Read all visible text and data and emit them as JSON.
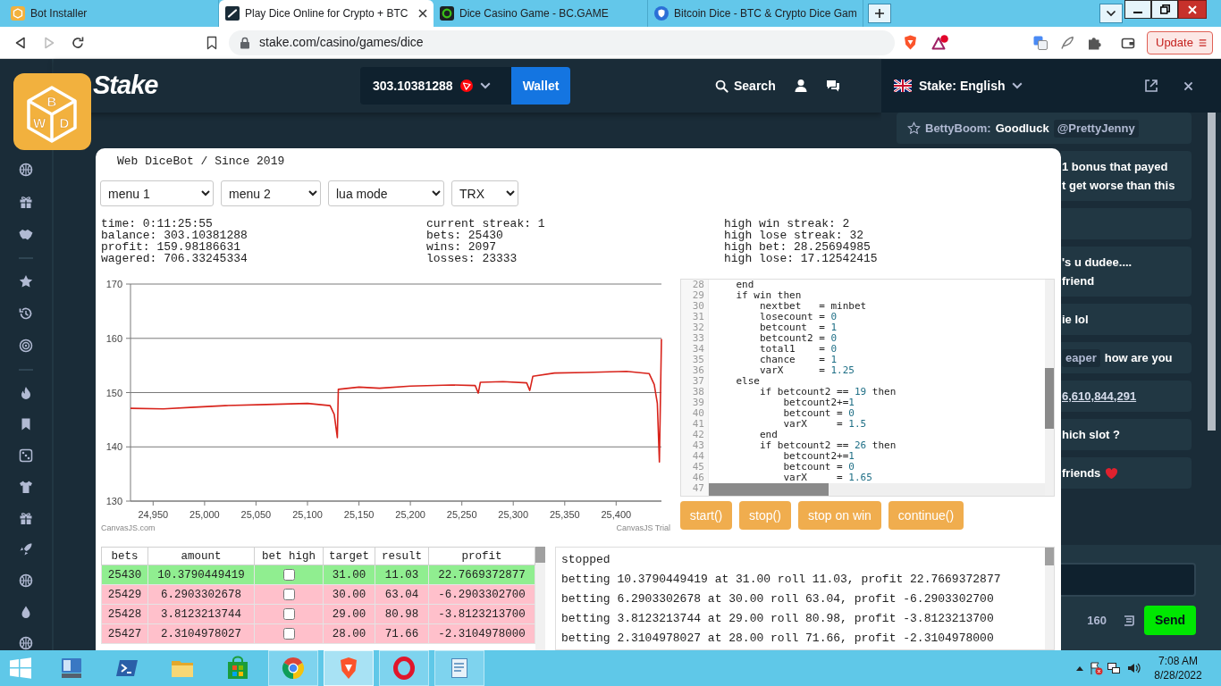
{
  "browser": {
    "tabs": [
      {
        "title": "Bot Installer",
        "kind": "cube",
        "selected": false
      },
      {
        "title": "Play Dice Online for Crypto + BTC",
        "kind": "tile",
        "selected": true
      },
      {
        "title": "Dice Casino Game - BC.GAME",
        "kind": "ring",
        "selected": false
      },
      {
        "title": "Bitcoin Dice - BTC & Crypto Dice Gam",
        "kind": "shield",
        "selected": false
      }
    ],
    "nav": [
      {
        "kind": "back",
        "disabled": false
      },
      {
        "kind": "forward",
        "disabled": true
      },
      {
        "kind": "reload",
        "disabled": false
      }
    ],
    "url": "stake.com/casino/games/dice",
    "update_button": "Update"
  },
  "site": {
    "logo": "Stake",
    "balance": "303.10381288",
    "wallet_button": "Wallet",
    "search_button": "Search"
  },
  "launcher": {
    "letters": [
      "B",
      "W",
      "D"
    ]
  },
  "chat": {
    "room": "Stake: English",
    "messages": [
      {
        "kind": "full",
        "lines": [
          [
            {
              "kind": "user",
              "text": "BettyBoom:"
            },
            {
              "kind": "text",
              "text": "Goodluck"
            },
            {
              "kind": "mention",
              "text": "@PrettyJenny"
            }
          ]
        ]
      },
      {
        "kind": "clipped",
        "lines": [
          [
            {
              "kind": "text",
              "text": "1 bonus that payed"
            }
          ],
          [
            {
              "kind": "text",
              "text": "t get worse than this"
            }
          ]
        ]
      },
      {
        "kind": "clipped"
      },
      {
        "kind": "clipped",
        "lines": [
          [
            {
              "kind": "text",
              "text": "'s u dudee...."
            }
          ],
          [
            {
              "kind": "text",
              "text": "friend"
            }
          ]
        ]
      },
      {
        "kind": "clipped",
        "lines": [
          [
            {
              "kind": "text",
              "text": "ie lol"
            }
          ]
        ]
      },
      {
        "kind": "clipped",
        "lines": [
          [
            {
              "kind": "mention",
              "text": "eaper"
            },
            {
              "kind": "text",
              "text": "how are you"
            }
          ]
        ]
      },
      {
        "kind": "clipped",
        "lines": [
          [
            {
              "kind": "link",
              "text": "6,610,844,291"
            }
          ]
        ]
      },
      {
        "kind": "clipped",
        "lines": [
          [
            {
              "kind": "text",
              "text": "hich slot ?"
            }
          ]
        ]
      },
      {
        "kind": "clipped",
        "lines": [
          [
            {
              "kind": "text",
              "text": "friends"
            },
            {
              "kind": "emoji"
            }
          ]
        ]
      }
    ],
    "char_count": "160",
    "send_button": "Send"
  },
  "dicebot": {
    "title": "Web DiceBot / Since 2019",
    "selects": [
      "menu 1",
      "menu 2",
      "lua mode",
      "TRX"
    ],
    "stats": [
      [
        "time: 0:11:25:55",
        "balance: 303.10381288",
        "profit: 159.98186631",
        "wagered: 706.33245334"
      ],
      [
        "current streak: 1",
        "bets: 25430",
        "wins: 2097",
        "losses: 23333"
      ],
      [
        "high win streak: 2",
        "high lose streak: 32",
        "high bet: 28.25694985",
        "high lose: 17.12542415"
      ]
    ],
    "chart_data": {
      "type": "line",
      "x": [
        24928,
        24960,
        24990,
        25020,
        25060,
        25100,
        25122,
        25126,
        25129,
        25130,
        25150,
        25170,
        25200,
        25240,
        25263,
        25266,
        25268,
        25290,
        25313,
        25316,
        25319,
        25340,
        25370,
        25410,
        25432,
        25437,
        25440,
        25442,
        25444
      ],
      "series": [
        {
          "color": "#d8231b",
          "values": [
            147.1,
            147.0,
            147.3,
            147.6,
            147.8,
            148.0,
            147.6,
            146.0,
            141.7,
            150.6,
            151.0,
            150.8,
            151.2,
            151.4,
            151.3,
            149.9,
            151.9,
            152.0,
            151.8,
            150.4,
            153.0,
            153.6,
            153.7,
            153.9,
            153.5,
            151.5,
            148.0,
            137.2,
            159.9
          ]
        }
      ],
      "xlim": [
        24928,
        25444
      ],
      "ylim": [
        130,
        170
      ],
      "xticks": [
        {
          "value": 24950,
          "label": "24,950"
        },
        {
          "value": 25000,
          "label": "25,000"
        },
        {
          "value": 25050,
          "label": "25,050"
        },
        {
          "value": 25100,
          "label": "25,100"
        },
        {
          "value": 25150,
          "label": "25,150"
        },
        {
          "value": 25200,
          "label": "25,200"
        },
        {
          "value": 25250,
          "label": "25,250"
        },
        {
          "value": 25300,
          "label": "25,300"
        },
        {
          "value": 25350,
          "label": "25,350"
        },
        {
          "value": 25400,
          "label": "25,400"
        }
      ],
      "yticks": [
        130,
        140,
        150,
        160,
        170
      ],
      "grid": true
    },
    "chart_credits": [
      "CanvasJS.com",
      "CanvasJS Trial"
    ],
    "code": [
      {
        "number": "28",
        "text": "    end"
      },
      {
        "number": "29",
        "text": "    if win then"
      },
      {
        "number": "30",
        "text": "        nextbet   = minbet"
      },
      {
        "number": "31",
        "text": "        losecount = 0"
      },
      {
        "number": "32",
        "text": "        betcount  = 1"
      },
      {
        "number": "33",
        "text": "        betcount2 = 0"
      },
      {
        "number": "34",
        "text": "        total1    = 0"
      },
      {
        "number": "35",
        "text": "        chance    = 1"
      },
      {
        "number": "36",
        "text": "        varX      = 1.25"
      },
      {
        "number": "37",
        "text": "    else"
      },
      {
        "number": "38",
        "text": "        if betcount2 == 19 then"
      },
      {
        "number": "39",
        "text": "            betcount2+=1"
      },
      {
        "number": "40",
        "text": "            betcount = 0"
      },
      {
        "number": "41",
        "text": "            varX     = 1.5"
      },
      {
        "number": "42",
        "text": "        end"
      },
      {
        "number": "43",
        "text": "        if betcount2 == 26 then"
      },
      {
        "number": "44",
        "text": "            betcount2+=1"
      },
      {
        "number": "45",
        "text": "            betcount = 0"
      },
      {
        "number": "46",
        "text": "            varX     = 1.65"
      },
      {
        "number": "47"
      }
    ],
    "buttons": [
      "start()",
      "stop()",
      "stop on win",
      "continue()"
    ],
    "table": {
      "columns": [
        "bets",
        "amount",
        "bet high",
        "target",
        "result",
        "profit"
      ],
      "rows": [
        {
          "bets": "25430",
          "amount": "10.3790449419",
          "bet_high": false,
          "target": "31.00",
          "result": "11.03",
          "profit": "22.7669372877",
          "won": true
        },
        {
          "bets": "25429",
          "amount": "6.2903302678",
          "bet_high": false,
          "target": "30.00",
          "result": "63.04",
          "profit": "-6.2903302700",
          "won": false
        },
        {
          "bets": "25428",
          "amount": "3.8123213744",
          "bet_high": false,
          "target": "29.00",
          "result": "80.98",
          "profit": "-3.8123213700",
          "won": false
        },
        {
          "bets": "25427",
          "amount": "2.3104978027",
          "bet_high": false,
          "target": "28.00",
          "result": "71.66",
          "profit": "-2.3104978000",
          "won": false
        }
      ]
    },
    "log": [
      "stopped",
      "betting 10.3790449419 at 31.00 roll 11.03, profit 22.7669372877",
      "betting 6.2903302678 at 30.00 roll 63.04, profit -6.2903302700",
      "betting 3.8123213744 at 29.00 roll 80.98, profit -3.8123213700",
      "betting 2.3104978027 at 28.00 roll 71.66, profit -2.3104978000"
    ]
  },
  "taskbar": {
    "apps": [
      {
        "kind": "server",
        "running": false,
        "selected": false
      },
      {
        "kind": "terminal",
        "running": false,
        "selected": false
      },
      {
        "kind": "folder",
        "running": false,
        "selected": false
      },
      {
        "kind": "store",
        "running": false,
        "selected": false
      },
      {
        "kind": "browser",
        "running": true,
        "selected": false
      },
      {
        "kind": "shield",
        "running": true,
        "selected": true
      },
      {
        "kind": "ring",
        "running": true,
        "selected": false
      },
      {
        "kind": "notepad",
        "running": true,
        "selected": false
      }
    ],
    "time": "7:08 AM",
    "date": "8/28/2022"
  }
}
